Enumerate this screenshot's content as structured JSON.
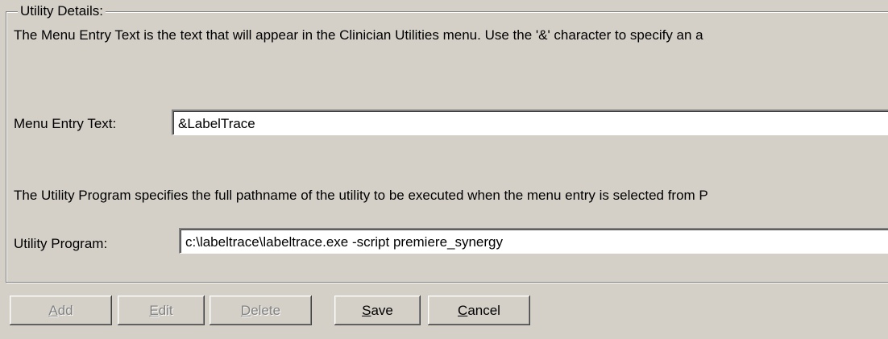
{
  "groupbox": {
    "title": "Utility Details:"
  },
  "menu_entry": {
    "description": "The Menu Entry Text is the text that will appear in the Clinician Utilities menu. Use the '&' character to specify an a",
    "label": "Menu Entry Text:",
    "value": "&LabelTrace"
  },
  "utility_program": {
    "description": "The Utility Program specifies the full pathname of the utility to be executed when the menu entry is selected from P",
    "label": "Utility Program:",
    "value": "c:\\labeltrace\\labeltrace.exe -script premiere_synergy"
  },
  "buttons": {
    "add": {
      "mnemonic": "A",
      "rest": "dd",
      "enabled": false
    },
    "edit": {
      "mnemonic": "E",
      "rest": "dit",
      "enabled": false
    },
    "delete": {
      "mnemonic": "D",
      "rest": "elete",
      "enabled": false
    },
    "save": {
      "mnemonic": "S",
      "rest": "ave",
      "enabled": true
    },
    "cancel": {
      "mnemonic": "C",
      "rest": "ancel",
      "enabled": true
    }
  }
}
